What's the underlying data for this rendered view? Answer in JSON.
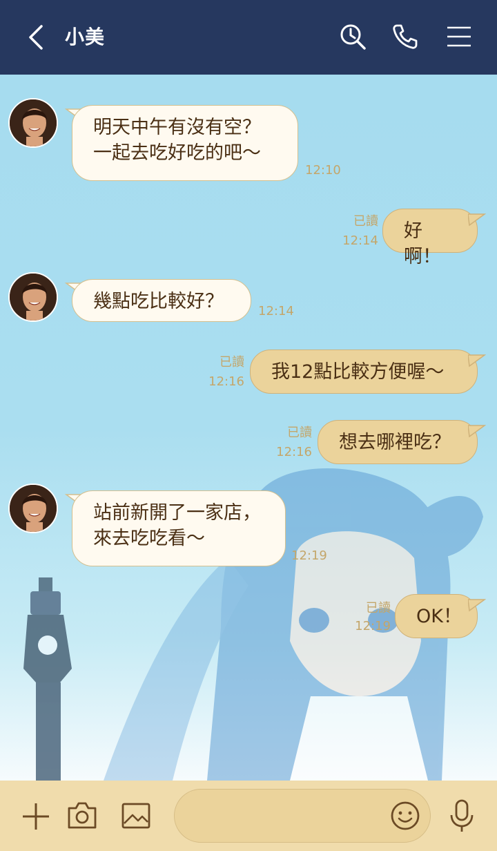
{
  "header": {
    "contact_name": "小美",
    "icons": [
      "back-icon",
      "search-icon",
      "phone-icon",
      "menu-icon"
    ]
  },
  "messages": [
    {
      "side": "received",
      "lines": [
        "明天中午有沒有空？",
        "一起去吃好吃的吧～"
      ],
      "time": "12:10"
    },
    {
      "side": "sent",
      "text": "好啊！",
      "status": "已讀",
      "time": "12:14"
    },
    {
      "side": "received",
      "text": "幾點吃比較好？",
      "time": "12:14"
    },
    {
      "side": "sent",
      "text": "我12點比較方便喔～",
      "status": "已讀",
      "time": "12:16"
    },
    {
      "side": "sent",
      "text": "想去哪裡吃？",
      "status": "已讀",
      "time": "12:16"
    },
    {
      "side": "received",
      "lines": [
        "站前新開了一家店，",
        "來去吃吃看～"
      ],
      "time": "12:19"
    },
    {
      "side": "sent",
      "text": "OK！",
      "status": "已讀",
      "time": "12:19"
    }
  ],
  "composer": {
    "input_value": "",
    "icons": [
      "plus-icon",
      "camera-icon",
      "image-icon",
      "emoji-icon",
      "microphone-icon"
    ]
  },
  "colors": {
    "header": "#26385f",
    "chat_background": "#a6dcef",
    "received_bubble": "#fffaf0",
    "sent_bubble": "#ebd39b",
    "composer": "#f0dcac",
    "meta_text": "#c4a66a",
    "bubble_text": "#4a2f14"
  }
}
